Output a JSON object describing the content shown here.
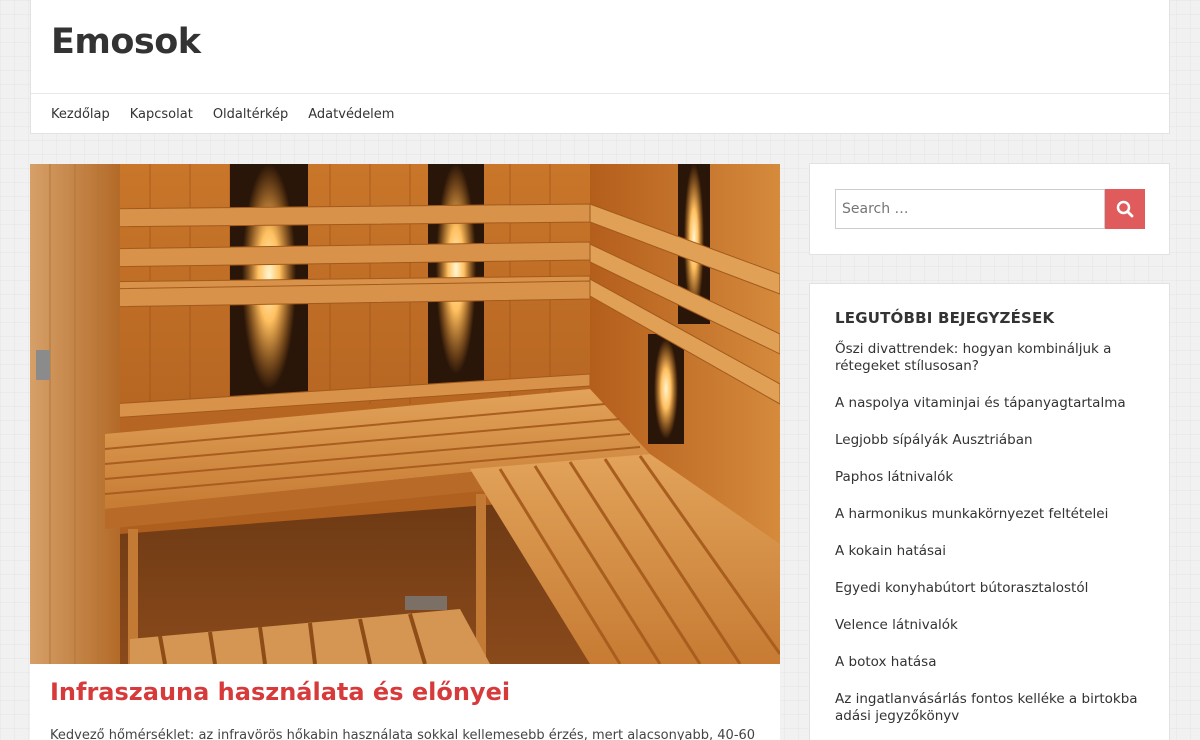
{
  "site": {
    "title": "Emosok"
  },
  "nav": {
    "items": [
      "Kezdőlap",
      "Kapcsolat",
      "Oldaltérkép",
      "Adatvédelem"
    ]
  },
  "post": {
    "title": "Infraszauna használata és előnyei",
    "excerpt": "Kedvező hőmérséklet: az infravörös hőkabin használata sokkal kellemesebb érzés, mert alacsonyabb, 40-60"
  },
  "search": {
    "placeholder": "Search …"
  },
  "recent": {
    "title": "LEGUTÓBBI BEJEGYZÉSEK",
    "items": [
      "Őszi divattrendek: hogyan kombináljuk a rétegeket stílusosan?",
      "A naspolya vitaminjai és tápanyagtartalma",
      "Legjobb sípályák Ausztriában",
      "Paphos látnivalók",
      "A harmonikus munkakörnyezet feltételei",
      "A kokain hatásai",
      "Egyedi konyhabútort bútorasztalostól",
      "Velence látnivalók",
      "A botox hatása",
      "Az ingatlanvásárlás fontos kelléke a birtokba adási jegyzőkönyv"
    ]
  },
  "colors": {
    "accent": "#e05b5b",
    "post_title": "#d63a3a"
  }
}
